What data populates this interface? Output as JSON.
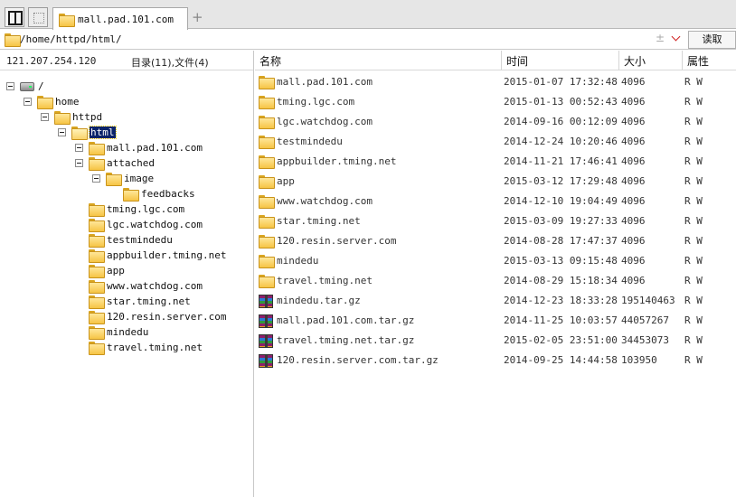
{
  "tab": {
    "title": "mall.pad.101.com",
    "add_symbol": "+"
  },
  "pathbar": {
    "path": "/home/httpd/html/",
    "sort_symbol": "±",
    "read_label": "读取"
  },
  "left": {
    "host": "121.207.254.120",
    "summary": "目录(11),文件(4)",
    "tree": [
      {
        "label": "/",
        "icon": "drive-icon",
        "toggle": true,
        "depth": 0
      },
      {
        "label": "home",
        "icon": "folder-icon",
        "toggle": true,
        "depth": 1
      },
      {
        "label": "httpd",
        "icon": "folder-icon",
        "toggle": true,
        "depth": 2
      },
      {
        "label": "html",
        "icon": "folder-open-icon",
        "toggle": true,
        "depth": 3,
        "selected": true
      },
      {
        "label": "mall.pad.101.com",
        "icon": "folder-icon",
        "toggle": true,
        "depth": 4
      },
      {
        "label": "attached",
        "icon": "folder-icon",
        "toggle": true,
        "depth": 5
      },
      {
        "label": "image",
        "icon": "folder-icon",
        "toggle": true,
        "depth": 6
      },
      {
        "label": "feedbacks",
        "icon": "folder-icon",
        "toggle": false,
        "depth": 7
      },
      {
        "label": "tming.lgc.com",
        "icon": "folder-icon",
        "toggle": false,
        "depth": 5
      },
      {
        "label": "lgc.watchdog.com",
        "icon": "folder-icon",
        "toggle": false,
        "depth": 5
      },
      {
        "label": "testmindedu",
        "icon": "folder-icon",
        "toggle": false,
        "depth": 5
      },
      {
        "label": "appbuilder.tming.net",
        "icon": "folder-icon",
        "toggle": false,
        "depth": 5
      },
      {
        "label": "app",
        "icon": "folder-icon",
        "toggle": false,
        "depth": 5
      },
      {
        "label": "www.watchdog.com",
        "icon": "folder-icon",
        "toggle": false,
        "depth": 5
      },
      {
        "label": "star.tming.net",
        "icon": "folder-icon",
        "toggle": false,
        "depth": 5
      },
      {
        "label": "120.resin.server.com",
        "icon": "folder-icon",
        "toggle": false,
        "depth": 5
      },
      {
        "label": "mindedu",
        "icon": "folder-icon",
        "toggle": false,
        "depth": 5
      },
      {
        "label": "travel.tming.net",
        "icon": "folder-icon",
        "toggle": false,
        "depth": 5
      }
    ]
  },
  "columns": {
    "name": "名称",
    "time": "时间",
    "size": "大小",
    "attr": "属性"
  },
  "files": [
    {
      "icon": "folder-icon",
      "name": "mall.pad.101.com",
      "time": "2015-01-07 17:32:48",
      "size": "4096",
      "attr": "R W"
    },
    {
      "icon": "folder-icon",
      "name": "tming.lgc.com",
      "time": "2015-01-13 00:52:43",
      "size": "4096",
      "attr": "R W"
    },
    {
      "icon": "folder-icon",
      "name": "lgc.watchdog.com",
      "time": "2014-09-16 00:12:09",
      "size": "4096",
      "attr": "R W"
    },
    {
      "icon": "folder-icon",
      "name": "testmindedu",
      "time": "2014-12-24 10:20:46",
      "size": "4096",
      "attr": "R W"
    },
    {
      "icon": "folder-icon",
      "name": "appbuilder.tming.net",
      "time": "2014-11-21 17:46:41",
      "size": "4096",
      "attr": "R W"
    },
    {
      "icon": "folder-icon",
      "name": "app",
      "time": "2015-03-12 17:29:48",
      "size": "4096",
      "attr": "R W"
    },
    {
      "icon": "folder-icon",
      "name": "www.watchdog.com",
      "time": "2014-12-10 19:04:49",
      "size": "4096",
      "attr": "R W"
    },
    {
      "icon": "folder-icon",
      "name": "star.tming.net",
      "time": "2015-03-09 19:27:33",
      "size": "4096",
      "attr": "R W"
    },
    {
      "icon": "folder-icon",
      "name": "120.resin.server.com",
      "time": "2014-08-28 17:47:37",
      "size": "4096",
      "attr": "R W"
    },
    {
      "icon": "folder-icon",
      "name": "mindedu",
      "time": "2015-03-13 09:15:48",
      "size": "4096",
      "attr": "R W"
    },
    {
      "icon": "folder-icon",
      "name": "travel.tming.net",
      "time": "2014-08-29 15:18:34",
      "size": "4096",
      "attr": "R W"
    },
    {
      "icon": "archive-icon",
      "name": "mindedu.tar.gz",
      "time": "2014-12-23 18:33:28",
      "size": "195140463",
      "attr": "R W"
    },
    {
      "icon": "archive-icon",
      "name": "mall.pad.101.com.tar.gz",
      "time": "2014-11-25 10:03:57",
      "size": "44057267",
      "attr": "R W"
    },
    {
      "icon": "archive-icon",
      "name": "travel.tming.net.tar.gz",
      "time": "2015-02-05 23:51:00",
      "size": "34453073",
      "attr": "R W"
    },
    {
      "icon": "archive-icon",
      "name": "120.resin.server.com.tar.gz",
      "time": "2014-09-25 14:44:58",
      "size": "103950",
      "attr": "R W"
    }
  ]
}
